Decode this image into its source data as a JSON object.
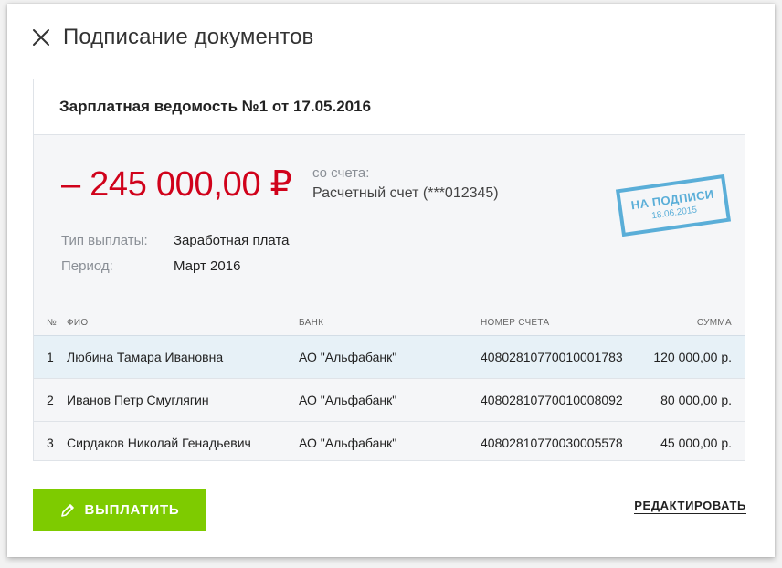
{
  "modal": {
    "title": "Подписание документов"
  },
  "card": {
    "title": "Зарплатная ведомость №1 от 17.05.2016",
    "amount": "– 245 000,00 ₽",
    "from_label": "со счета:",
    "from_account": "Расчетный счет (***012345)",
    "payment_type_label": "Тип выплаты:",
    "payment_type_value": "Заработная плата",
    "period_label": "Период:",
    "period_value": "Март 2016",
    "stamp": {
      "title": "НА ПОДПИСИ",
      "date": "18.06.2015",
      "color": "#5aaed8"
    }
  },
  "table": {
    "headers": {
      "num": "№",
      "name": "ФИО",
      "bank": "БАНК",
      "account": "НОМЕР СЧЕТА",
      "sum": "СУММА"
    },
    "rows": [
      {
        "num": "1",
        "name": "Любина Тамара Ивановна",
        "bank": "АО \"Альфабанк\"",
        "account": "40802810770010001783",
        "sum": "120 000,00 р."
      },
      {
        "num": "2",
        "name": "Иванов Петр Смуглягин",
        "bank": "АО \"Альфабанк\"",
        "account": "40802810770010008092",
        "sum": "80 000,00 р."
      },
      {
        "num": "3",
        "name": "Сирдаков Николай Генадьевич",
        "bank": "АО \"Альфабанк\"",
        "account": "40802810770030005578",
        "sum": "45 000,00 р."
      }
    ]
  },
  "actions": {
    "pay_label": "ВЫПЛАТИТЬ",
    "pay_icon": "pen-icon",
    "edit_label": "РЕДАКТИРОВАТЬ"
  },
  "colors": {
    "accent_green": "#7ecb00",
    "amount_red": "#d0021b",
    "selected_row": "#e7f1f7"
  }
}
